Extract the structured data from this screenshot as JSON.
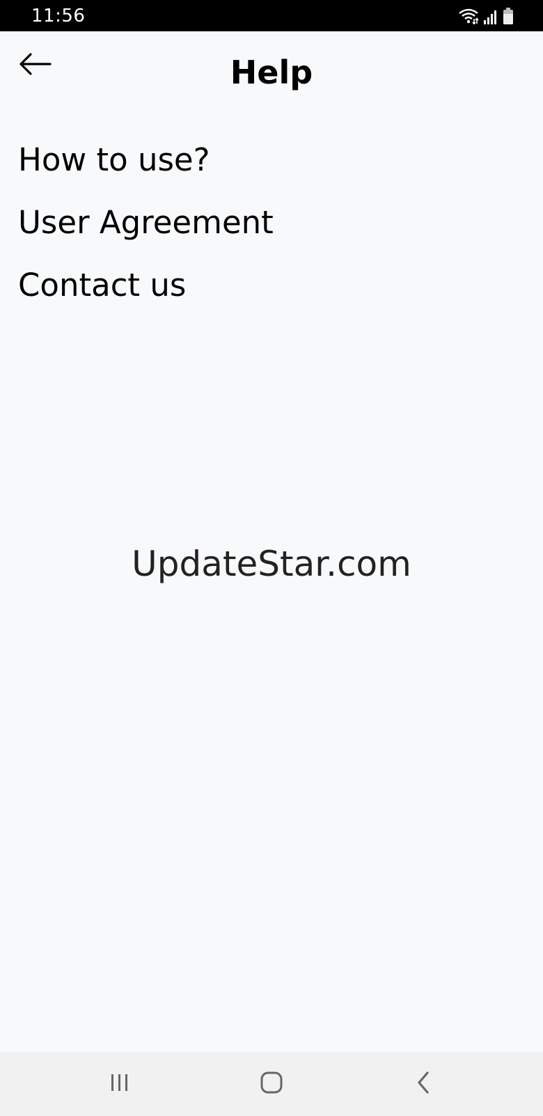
{
  "status_bar": {
    "time": "11:56",
    "icons": [
      "wifi-icon",
      "signal-icon",
      "battery-icon"
    ]
  },
  "header": {
    "title": "Help",
    "back_icon": "arrow-left-icon"
  },
  "menu": {
    "items": [
      {
        "label": "How to use?"
      },
      {
        "label": "User Agreement"
      },
      {
        "label": "Contact us"
      }
    ]
  },
  "footer": {
    "brand": "UpdateStar.com"
  },
  "nav_bar": {
    "buttons": [
      "recents-icon",
      "home-icon",
      "back-icon"
    ]
  },
  "colors": {
    "background": "#f8f9fb",
    "status_bar": "#000000",
    "nav_bar": "#f1f1f1",
    "text": "#000000"
  }
}
